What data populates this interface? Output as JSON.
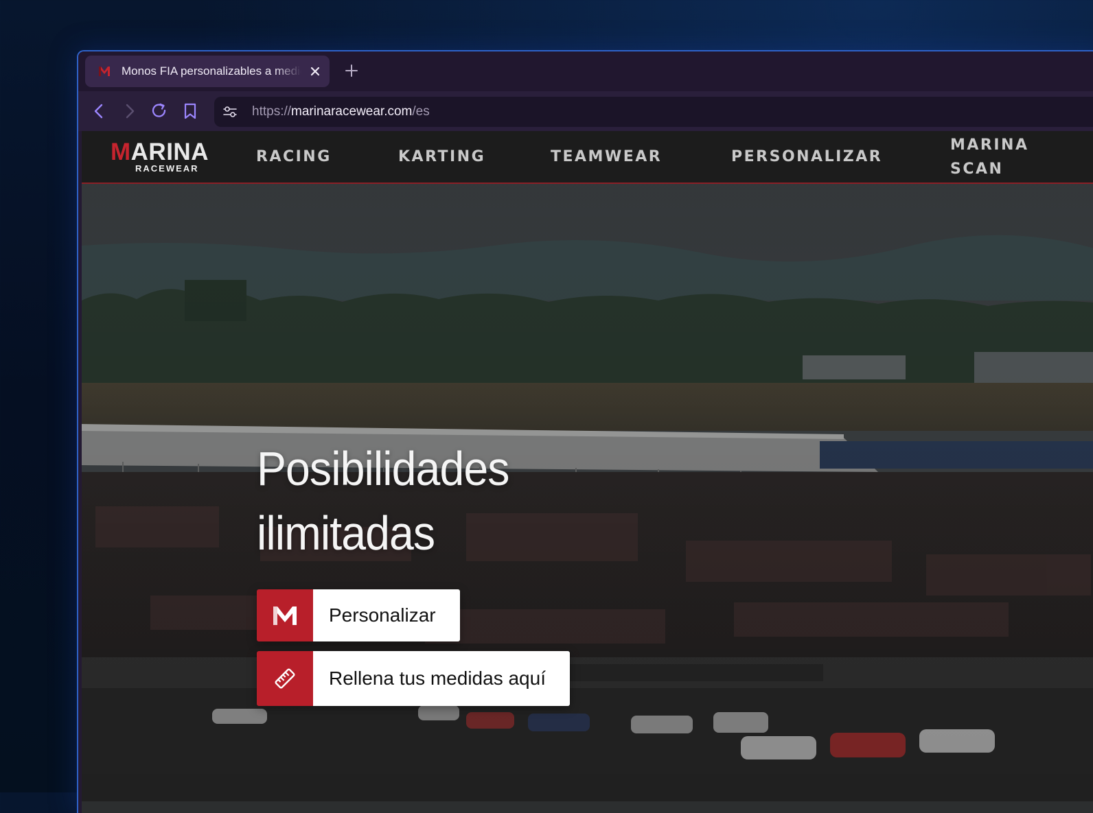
{
  "browser": {
    "tab": {
      "title": "Monos FIA personalizables a medida",
      "favicon": "marina-m-icon"
    },
    "url": {
      "scheme": "https://",
      "host": "marinaracewear.com",
      "path": "/es"
    }
  },
  "site": {
    "logo": {
      "initial": "M",
      "word_rest": "ARINA",
      "subtitle": "RACEWEAR"
    },
    "nav": [
      {
        "label": "RACING"
      },
      {
        "label": "KARTING"
      },
      {
        "label": "TEAMWEAR"
      },
      {
        "label": "PERSONALIZAR"
      },
      {
        "label": "MARINA SCAN"
      }
    ]
  },
  "hero": {
    "title_line1": "Posibilidades",
    "title_line2": "ilimitadas",
    "buttons": [
      {
        "label": "Personalizar",
        "icon": "marina-m-icon"
      },
      {
        "label": "Rellena tus medidas aquí",
        "icon": "ruler-icon"
      }
    ]
  },
  "colors": {
    "brand_red": "#b81f2a",
    "nav_text": "#c9c9c9",
    "header_bg": "#1c1c1c"
  }
}
